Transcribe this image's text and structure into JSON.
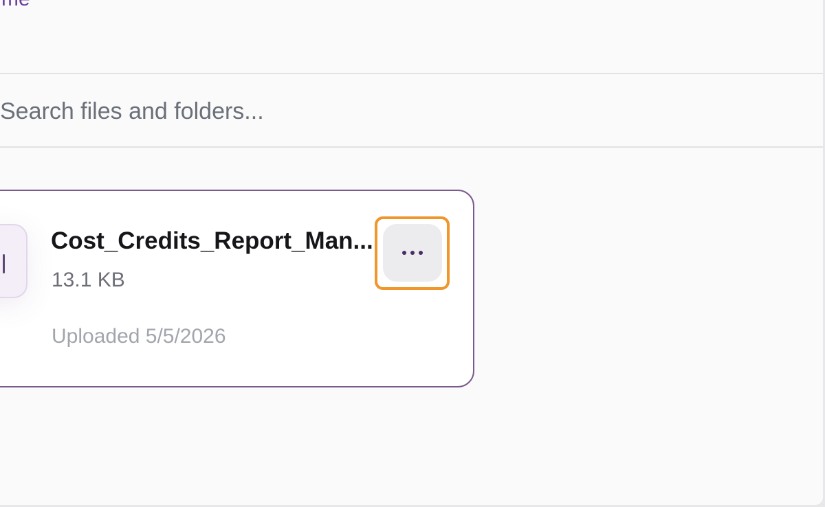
{
  "header": {
    "clipped_label": "me"
  },
  "search": {
    "placeholder": "Search files and folders..."
  },
  "file_card": {
    "name": "Cost_Credits_Report_Man...",
    "size": "13.1 KB",
    "uploaded": "Uploaded 5/5/2026",
    "more_icon": "more-horizontal-icon"
  },
  "colors": {
    "card_border": "#7a5a8c",
    "highlight": "#f0962b",
    "dots": "#4a2c69",
    "accent": "#6b3fa0"
  }
}
